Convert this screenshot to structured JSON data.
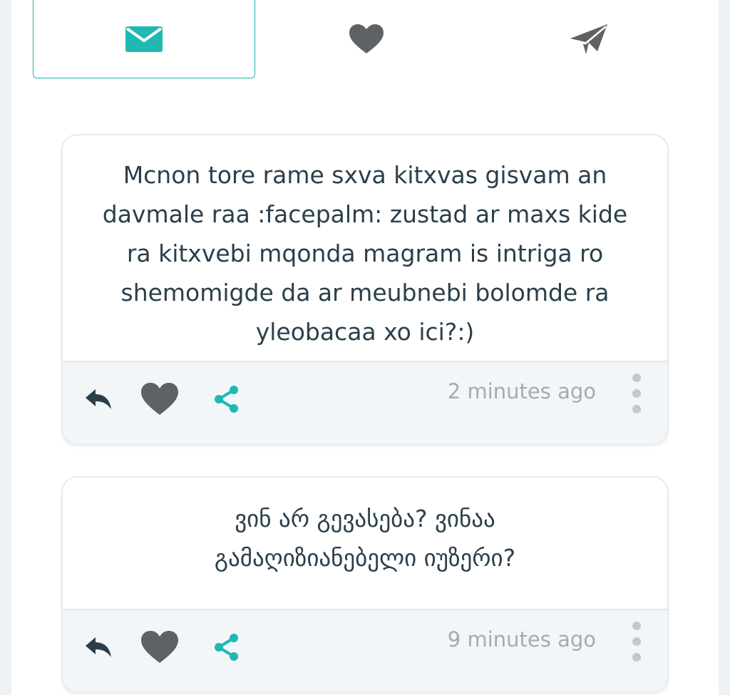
{
  "tabs": [
    {
      "icon": "envelope-icon",
      "active": true
    },
    {
      "icon": "heart-icon",
      "active": false
    },
    {
      "icon": "paper-plane-icon",
      "active": false
    }
  ],
  "colors": {
    "accent": "#1fb8b2",
    "text": "#2b3f4a",
    "icon_gray": "#5f6264",
    "muted": "#a6abaf",
    "footer_bg": "#f3f6f8"
  },
  "questions": [
    {
      "text": "Mcnon tore rame sxva kitxvas gisvam an davmale raa :facepalm: zustad ar maxs kide ra kitxvebi mqonda magram is intriga ro shemomigde da ar meubnebi bolomde ra yleobacaa xo ici?:)",
      "time": "2 minutes ago"
    },
    {
      "text": "ვინ არ გევასება? ვინაა გამაღიზიანებელი იუზერი?",
      "time": "9 minutes ago"
    }
  ]
}
